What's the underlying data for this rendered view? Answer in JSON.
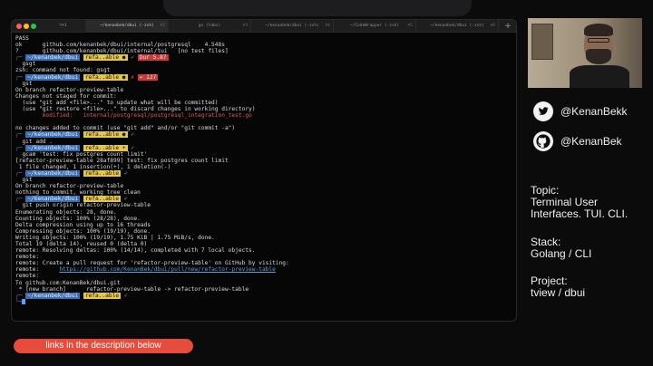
{
  "terminal": {
    "tabs": [
      {
        "label": "⌥⌘1",
        "num": ""
      },
      {
        "label": "~/kenanbek/dbui (-zsh)",
        "num": "⌘2"
      },
      {
        "label": "go (tabs)",
        "num": "⌘3"
      },
      {
        "label": "~/kenanbek/dbui (-zsh)",
        "num": "⌘4"
      },
      {
        "label": "~/CodeWrapper (-zsh)",
        "num": "⌘5"
      },
      {
        "label": "~/kenanbek/dbui (-zsh)",
        "num": "⌘6"
      }
    ],
    "add_tab": "+",
    "lines": [
      {
        "type": "text",
        "text": "PASS"
      },
      {
        "type": "text",
        "text": "ok      github.com/kenanbek/dbui/internal/postgresql    4.548s"
      },
      {
        "type": "text",
        "text": "?       github.com/kenanbek/dbui/internal/tui   [no test files]"
      },
      {
        "type": "prompt",
        "path": "~/kenanbek/dbui",
        "git": "refa..able ●",
        "status": "✓",
        "extra": "Dur 5.87",
        "extra_class": "err"
      },
      {
        "type": "text",
        "text": "  gsgt"
      },
      {
        "type": "text",
        "text": "zsh: command not found: gsgt"
      },
      {
        "type": "prompt",
        "path": "~/kenanbek/dbui",
        "git": "refa..able ●",
        "status": "✗",
        "extra": "↩ 127",
        "extra_class": "err"
      },
      {
        "type": "text",
        "text": "  gst"
      },
      {
        "type": "text",
        "text": "On branch refactor-preview-table"
      },
      {
        "type": "text",
        "text": "Changes not staged for commit:"
      },
      {
        "type": "text",
        "text": "  (use \"git add <file>...\" to update what will be committed)"
      },
      {
        "type": "text",
        "text": "  (use \"git restore <file>...\" to discard changes in working directory)"
      },
      {
        "type": "red",
        "text": "        modified:   internal/postgresql/postgresql_integration_test.go"
      },
      {
        "type": "text",
        "text": " "
      },
      {
        "type": "text",
        "text": "no changes added to commit (use \"git add\" and/or \"git commit -a\")"
      },
      {
        "type": "prompt",
        "path": "~/kenanbek/dbui",
        "git": "refa..able ●",
        "status": "✓",
        "extra": "",
        "extra_class": ""
      },
      {
        "type": "text",
        "text": "  git add ."
      },
      {
        "type": "prompt",
        "path": "~/kenanbek/dbui",
        "git": "refa..able +",
        "status": "✓",
        "extra": "",
        "extra_class": ""
      },
      {
        "type": "text",
        "text": "  gcam 'test: fix postgres count limit'"
      },
      {
        "type": "text",
        "text": "[refactor-preview-table 28af899] test: fix postgres count limit"
      },
      {
        "type": "text",
        "text": " 1 file changed, 1 insertion(+), 1 deletion(-)"
      },
      {
        "type": "prompt",
        "path": "~/kenanbek/dbui",
        "git": "refa..able",
        "status": "✓",
        "extra": "",
        "extra_class": ""
      },
      {
        "type": "text",
        "text": "  gst"
      },
      {
        "type": "text",
        "text": "On branch refactor-preview-table"
      },
      {
        "type": "text",
        "text": "nothing to commit, working tree clean"
      },
      {
        "type": "prompt",
        "path": "~/kenanbek/dbui",
        "git": "refa..able",
        "status": "✓",
        "extra": "",
        "extra_class": ""
      },
      {
        "type": "text",
        "text": "  git push origin refactor-preview-table"
      },
      {
        "type": "text",
        "text": "Enumerating objects: 28, done."
      },
      {
        "type": "text",
        "text": "Counting objects: 100% (28/28), done."
      },
      {
        "type": "text",
        "text": "Delta compression using up to 16 threads"
      },
      {
        "type": "text",
        "text": "Compressing objects: 100% (19/19), done."
      },
      {
        "type": "text",
        "text": "Writing objects: 100% (19/19), 1.75 KiB | 1.75 MiB/s, done."
      },
      {
        "type": "text",
        "text": "Total 19 (delta 14), reused 0 (delta 0)"
      },
      {
        "type": "text",
        "text": "remote: Resolving deltas: 100% (14/14), completed with 7 local objects."
      },
      {
        "type": "text",
        "text": "remote:"
      },
      {
        "type": "text",
        "text": "remote: Create a pull request for 'refactor-preview-table' on GitHub by visiting:"
      },
      {
        "type": "link",
        "prefix": "remote:      ",
        "text": "https://github.com/KenanBek/dbui/pull/new/refactor-preview-table"
      },
      {
        "type": "text",
        "text": "remote:"
      },
      {
        "type": "text",
        "text": "To github.com:KenanBek/dbui.git"
      },
      {
        "type": "text",
        "text": " * [new branch]      refactor-preview-table -> refactor-preview-table"
      },
      {
        "type": "prompt",
        "path": "~/kenanbek/dbui",
        "git": "refa..able",
        "status": "✓",
        "extra": "",
        "extra_class": ""
      },
      {
        "type": "cursor",
        "text": ""
      }
    ]
  },
  "social": {
    "twitter_icon": "twitter-bird-icon",
    "twitter_handle": "@KenanBekk",
    "github_icon": "github-octocat-icon",
    "github_handle": "@KenanBek"
  },
  "info": {
    "topic_label": "Topic:",
    "topic_line1": "Terminal User",
    "topic_line2": "Interfaces. TUI. CLI.",
    "stack_label": "Stack:",
    "stack_value": "Golang / CLI",
    "project_label": "Project:",
    "project_value": "tview / dbui"
  },
  "banner": {
    "text": "links in the description below"
  },
  "colors": {
    "accent": "#e74b3c",
    "prompt_path": "#3a6fb4",
    "prompt_git": "#e4c64a",
    "prompt_error": "#c63b3b"
  }
}
